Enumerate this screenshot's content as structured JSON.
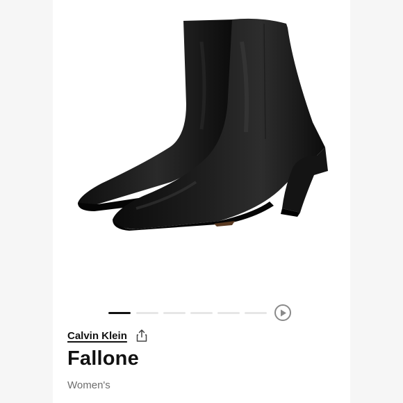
{
  "product": {
    "brand": "Calvin Klein",
    "name": "Fallone",
    "gender": "Women's",
    "image_alt": "black-leather-pointed-toe-ankle-boots"
  },
  "carousel": {
    "total_slides": 6,
    "active_index": 0
  },
  "icons": {
    "share": "share-icon",
    "play": "play-icon"
  },
  "colors": {
    "text": "#111111",
    "muted": "#6d6d6d",
    "indicator_active": "#111111",
    "indicator_inactive": "#e6e6e6"
  }
}
